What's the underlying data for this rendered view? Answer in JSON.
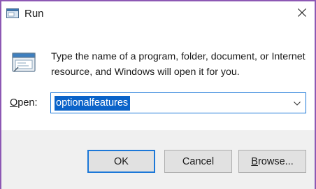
{
  "window": {
    "title": "Run",
    "accent_color": "#8d58b4",
    "focus_color": "#1c78d8"
  },
  "icons": {
    "title": "run-app-icon",
    "close": "close-icon",
    "run": "run-dialog-icon",
    "dropdown": "chevron-down-icon"
  },
  "content": {
    "description": "Type the name of a program, folder, document, or Internet resource, and Windows will open it for you."
  },
  "open_field": {
    "label_access_key": "O",
    "label_rest": "pen:",
    "value": "optionalfeatures",
    "selection_color": "#0a63c9"
  },
  "buttons": {
    "ok": "OK",
    "cancel": "Cancel",
    "browse_access_key": "B",
    "browse_rest": "rowse..."
  }
}
